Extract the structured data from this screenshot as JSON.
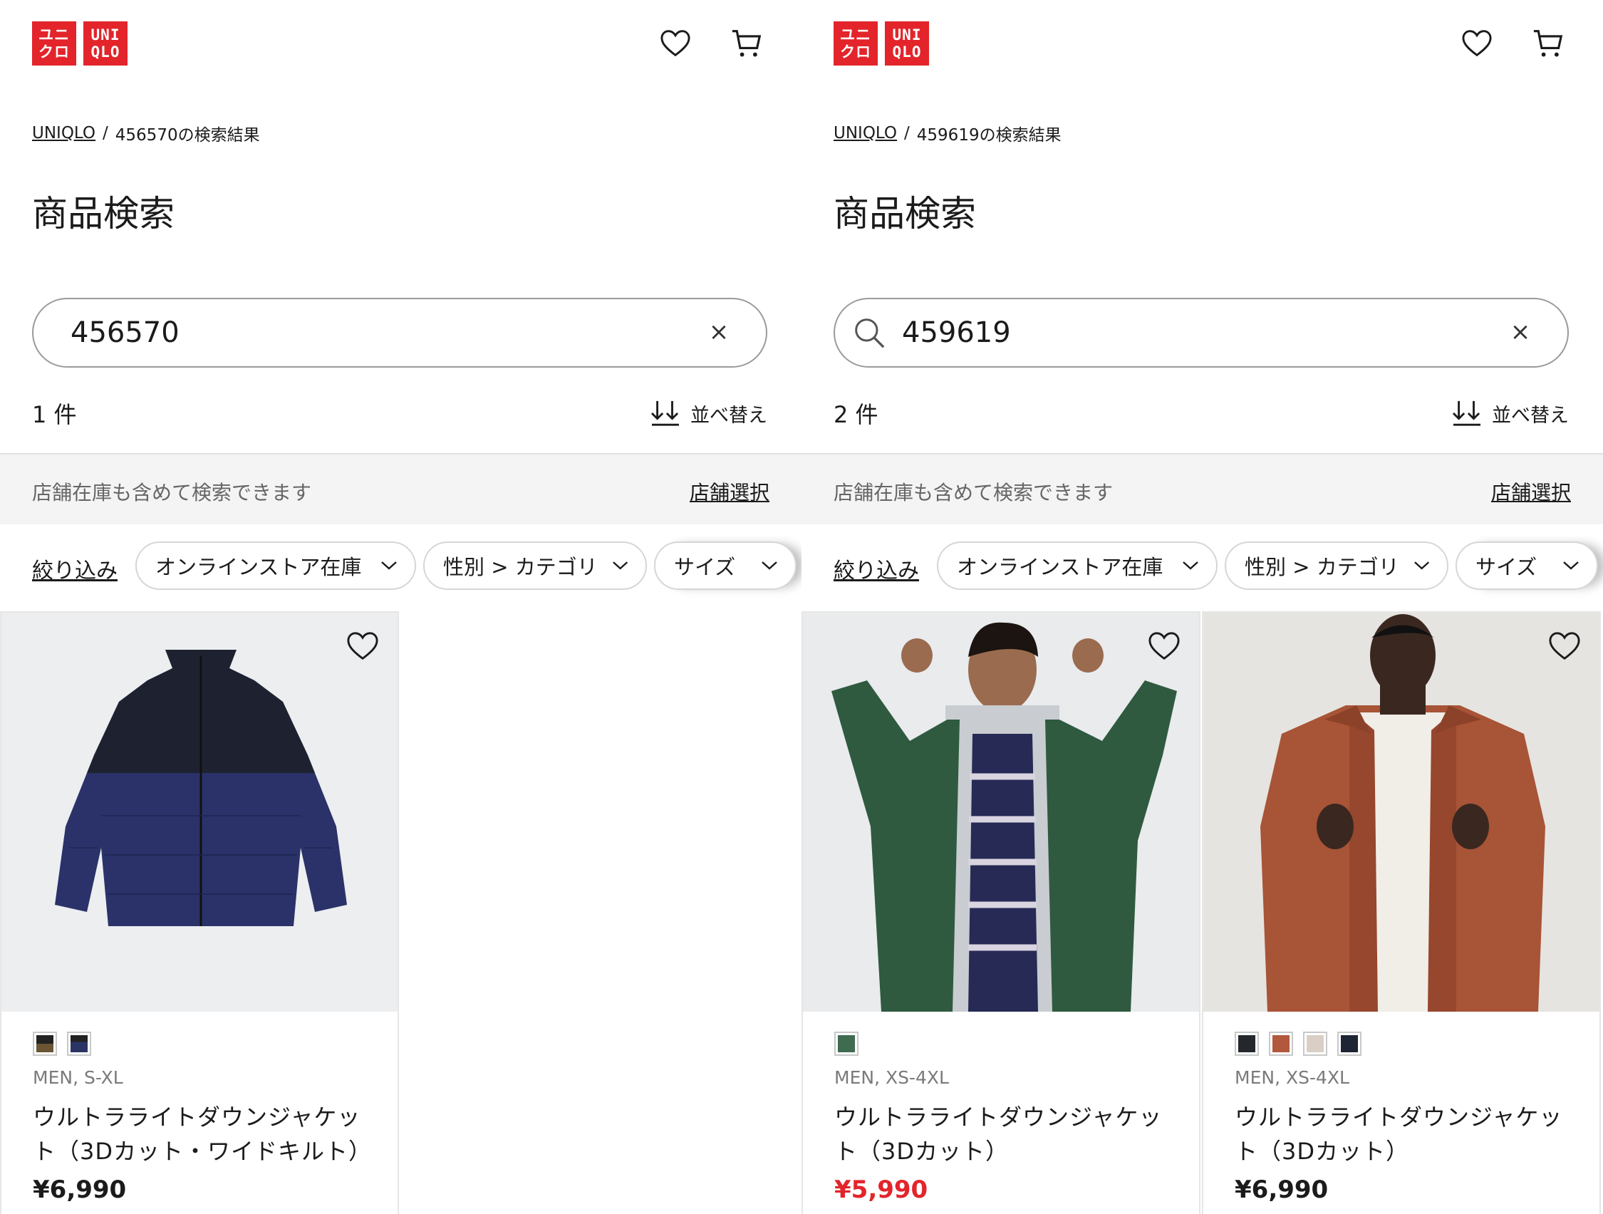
{
  "brand": {
    "logo_jp": [
      "ユニ",
      "クロ"
    ],
    "logo_en": [
      "UNI",
      "QLO"
    ],
    "color": "#e3242b"
  },
  "common": {
    "page_title": "商品検索",
    "store_message": "店舗在庫も含めて検索できます",
    "store_select": "店舗選択",
    "sort_label": "並べ替え",
    "filter_link": "絞り込み",
    "chips": [
      "オンラインストア在庫",
      "性別 > カテゴリ",
      "サイズ"
    ],
    "breadcrumb_home": "UNIQLO",
    "breadcrumb_sep": "/",
    "clear_symbol": "×"
  },
  "left": {
    "breadcrumb_current": "456570の検索結果",
    "search_value": "456570",
    "count": "1 件",
    "products": [
      {
        "gender_size": "MEN, S-XL",
        "name": "ウルトラライトダウンジャケット（3Dカット・ワイドキルト）",
        "price": "¥6,990",
        "swatches": [
          "#6b5534",
          "#2a3566"
        ]
      }
    ]
  },
  "right": {
    "breadcrumb_current": "459619の検索結果",
    "search_value": "459619",
    "count": "2 件",
    "products": [
      {
        "gender_size": "MEN, XS-4XL",
        "name": "ウルトラライトダウンジャケット（3Dカット）",
        "price": "¥5,990",
        "sale": true,
        "swatches": [
          "#3f6b50"
        ]
      },
      {
        "gender_size": "MEN, XS-4XL",
        "name": "ウルトラライトダウンジャケット（3Dカット）",
        "price": "¥6,990",
        "swatches": [
          "#24272c",
          "#b2583c",
          "#d9cfc4",
          "#1d2433"
        ]
      }
    ]
  }
}
